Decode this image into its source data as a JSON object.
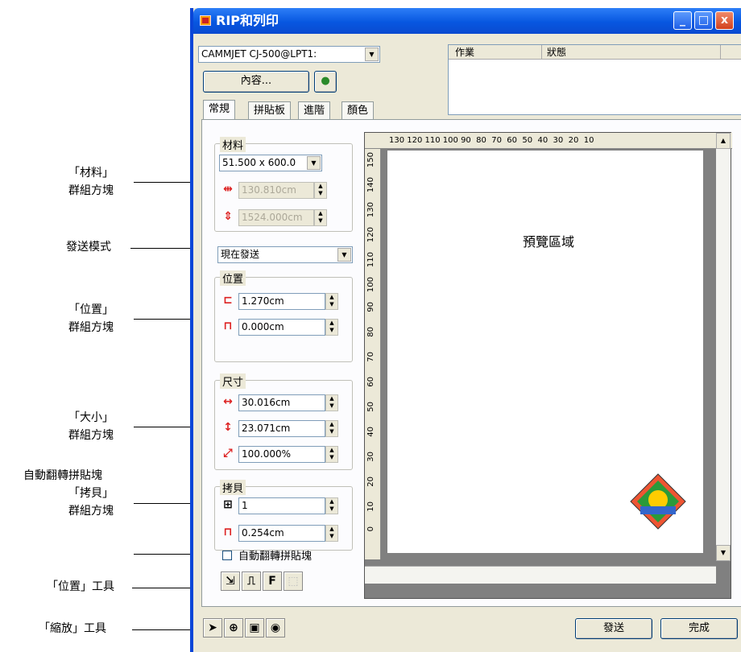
{
  "annotations": {
    "material": "「材料」\n群組方塊",
    "send_mode": "發送模式",
    "position": "「位置」\n群組方塊",
    "size": "「大小」\n群組方塊",
    "auto_rotate": "自動翻轉拼貼塊",
    "copies": "「拷貝」\n群組方塊",
    "position_tools": "「位置」工具",
    "zoom_tools": "「縮放」工具"
  },
  "window": {
    "title": "RIP和列印"
  },
  "printer": {
    "selected": "CAMMJET CJ-500@LPT1:"
  },
  "props_button": "內容...",
  "jobs": {
    "columns": [
      "作業",
      "狀態"
    ]
  },
  "tabs": [
    "常規",
    "拼貼板",
    "進階",
    "顏色"
  ],
  "material": {
    "label": "材料",
    "selected": "51.500 x 600.0",
    "width": "130.810cm",
    "length": "1524.000cm"
  },
  "send_mode": {
    "selected": "現在發送"
  },
  "position": {
    "label": "位置",
    "x": "1.270cm",
    "y": "0.000cm"
  },
  "size": {
    "label": "尺寸",
    "width": "30.016cm",
    "height": "23.071cm",
    "scale": "100.000%"
  },
  "copies": {
    "label": "拷貝",
    "count": "1",
    "spacing": "0.254cm"
  },
  "auto_rotate": {
    "label": "自動翻轉拼貼塊",
    "checked": false
  },
  "preview": {
    "label": "預覽區域"
  },
  "ruler": {
    "h": "130 120 110 100 90  80  70  60  50  40  30  20  10",
    "v": [
      "150",
      "140",
      "130",
      "120",
      "110",
      "100",
      "90",
      "80",
      "70",
      "60",
      "50",
      "40",
      "30",
      "20",
      "10",
      "0"
    ]
  },
  "buttons": {
    "send": "發送",
    "done": "完成"
  },
  "position_tools": [
    "⇲",
    "⎍",
    "F",
    "⬚"
  ],
  "zoom_tools": [
    "➤",
    "⊕",
    "▣",
    "◉"
  ]
}
